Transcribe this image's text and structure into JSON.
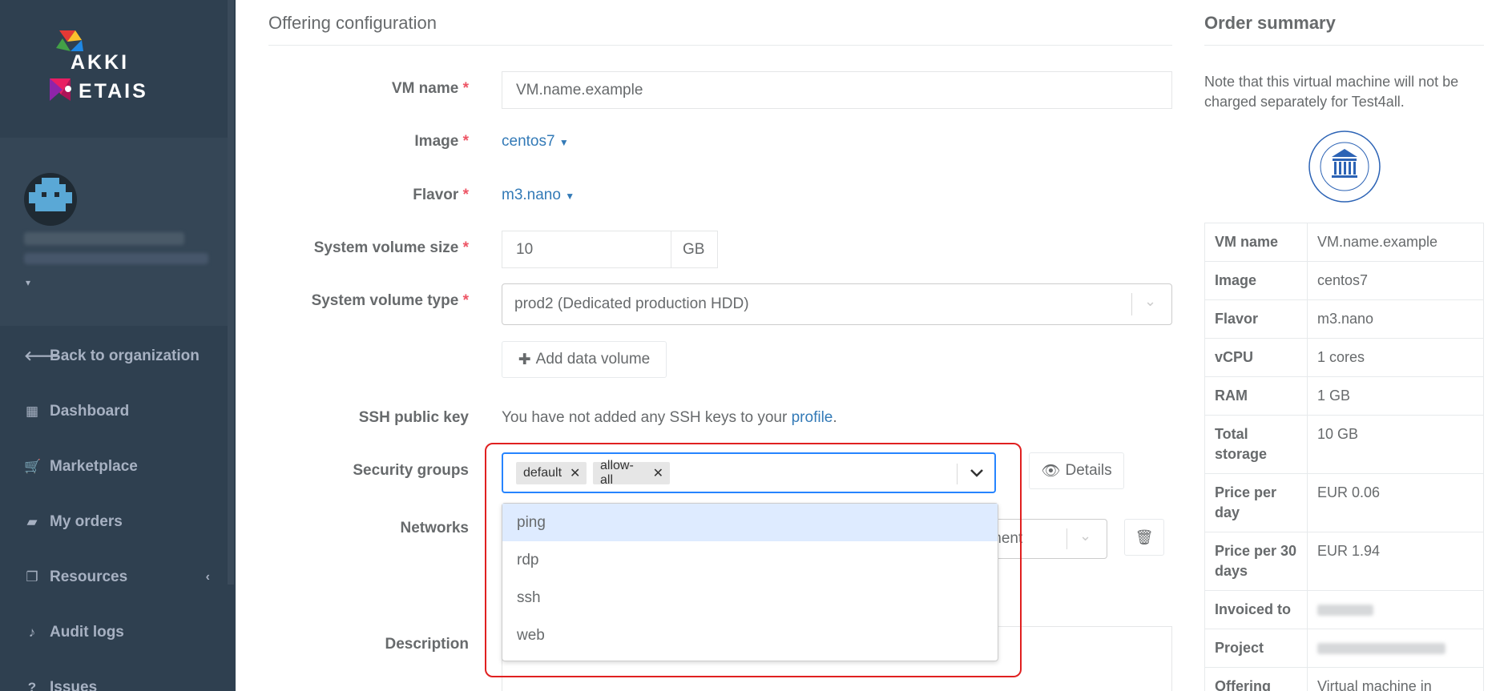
{
  "sidebar": {
    "logo_line1": "AKKI",
    "logo_line2": "ETAIS",
    "nav": [
      {
        "label": "Back to organization",
        "icon": "arrow-left-icon"
      },
      {
        "label": "Dashboard",
        "icon": "grid-icon"
      },
      {
        "label": "Marketplace",
        "icon": "cart-icon"
      },
      {
        "label": "My orders",
        "icon": "folder-icon"
      },
      {
        "label": "Resources",
        "icon": "copy-icon"
      },
      {
        "label": "Audit logs",
        "icon": "bell-icon"
      },
      {
        "label": "Issues",
        "icon": "question-icon"
      }
    ]
  },
  "form": {
    "title": "Offering configuration",
    "vm_name_label": "VM name",
    "vm_name_value": "VM.name.example",
    "image_label": "Image",
    "image_value": "centos7",
    "flavor_label": "Flavor",
    "flavor_value": "m3.nano",
    "volume_size_label": "System volume size",
    "volume_size_value": "10",
    "volume_size_unit": "GB",
    "volume_type_label": "System volume type",
    "volume_type_value": "prod2 (Dedicated production HDD)",
    "add_data_volume": "Add data volume",
    "ssh_label": "SSH public key",
    "ssh_text": "You have not added any SSH keys to your",
    "ssh_link": "profile",
    "ssh_period": ".",
    "security_groups_label": "Security groups",
    "security_groups_selected": [
      "default",
      "allow-all"
    ],
    "security_groups_options": [
      "ping",
      "rdp",
      "ssh",
      "web"
    ],
    "details_button": "Details",
    "networks_label": "Networks",
    "networks_value_partial": "ment",
    "description_label": "Description",
    "required_mark": "*"
  },
  "summary": {
    "title": "Order summary",
    "note": "Note that this virtual machine will not be charged separately for Test4all.",
    "rows": [
      {
        "key": "VM name",
        "value": "VM.name.example"
      },
      {
        "key": "Image",
        "value": "centos7"
      },
      {
        "key": "Flavor",
        "value": "m3.nano"
      },
      {
        "key": "vCPU",
        "value": "1 cores"
      },
      {
        "key": "RAM",
        "value": "1 GB"
      },
      {
        "key": "Total storage",
        "value": "10 GB"
      },
      {
        "key": "Price per day",
        "value": "EUR 0.06"
      },
      {
        "key": "Price per 30 days",
        "value": "EUR 1.94"
      },
      {
        "key": "Invoiced to",
        "value": ""
      },
      {
        "key": "Project",
        "value": ""
      },
      {
        "key": "Offering",
        "value": "Virtual machine in"
      }
    ]
  },
  "colors": {
    "sidebar_bg": "#2f4050",
    "link": "#337ab7",
    "required": "#ed5565",
    "highlight": "#e02020",
    "option_active": "#deebff"
  }
}
